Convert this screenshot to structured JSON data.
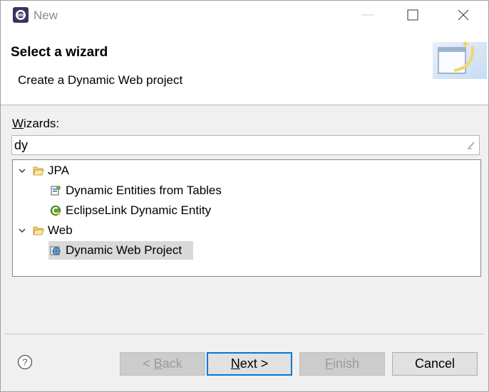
{
  "window": {
    "title": "New",
    "controls": [
      "minimize-icon",
      "maximize-icon",
      "close-icon"
    ]
  },
  "banner": {
    "title": "Select a wizard",
    "description": "Create a Dynamic Web project"
  },
  "wizards": {
    "label_prefix": "W",
    "label_rest": "izards:",
    "filter_value": "dy"
  },
  "tree": {
    "groups": [
      {
        "label": "JPA",
        "expanded": true,
        "items": [
          {
            "label": "Dynamic Entities from Tables",
            "icon": "jpa-entities-icon"
          },
          {
            "label": "EclipseLink Dynamic Entity",
            "icon": "eclipselink-entity-icon"
          }
        ]
      },
      {
        "label": "Web",
        "expanded": true,
        "items": [
          {
            "label": "Dynamic Web Project",
            "icon": "web-project-icon",
            "selected": true
          }
        ]
      }
    ]
  },
  "buttons": {
    "back_prefix": "< ",
    "back_mnemonic": "B",
    "back_rest": "ack",
    "next_mnemonic": "N",
    "next_rest": "ext >",
    "finish_mnemonic": "F",
    "finish_rest": "inish",
    "cancel": "Cancel"
  },
  "colors": {
    "accent": "#0078d7",
    "selection": "#d9d9d9",
    "disabled_text": "#9a9a9a"
  }
}
